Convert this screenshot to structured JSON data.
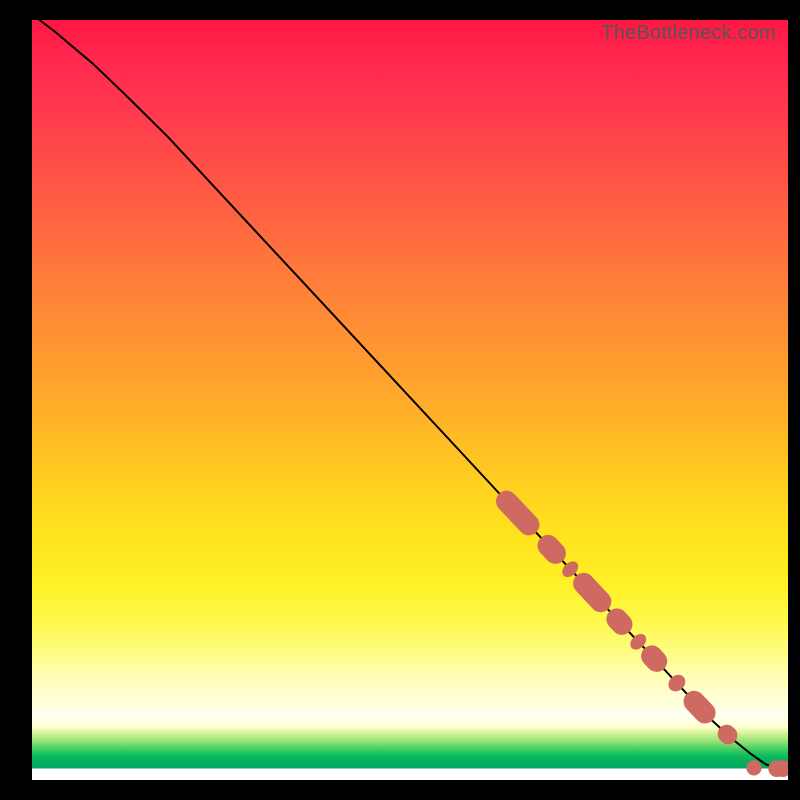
{
  "watermark": "TheBottleneck.com",
  "colors": {
    "background_frame": "#000000",
    "curve": "#000000",
    "marker": "#cf6a62",
    "gradient_top": "#ff1744",
    "gradient_mid": "#ffd91e",
    "gradient_low": "#01a85d",
    "gradient_bottom_band": "#ffffff"
  },
  "chart_data": {
    "type": "line",
    "title": "",
    "xlabel": "",
    "ylabel": "",
    "xlim": [
      0,
      100
    ],
    "ylim": [
      0,
      100
    ],
    "note": "No axis ticks or labels are rendered; values are read from the curve geometry normalized to 0–100. Curve starts near top-left, descends roughly linearly, and flattens near zero at the far right.",
    "series": [
      {
        "name": "curve",
        "x": [
          1,
          3,
          5,
          8,
          12,
          18,
          25,
          35,
          45,
          55,
          62,
          66,
          70,
          74,
          78,
          82,
          86,
          90,
          92.5,
          95,
          97,
          98.5,
          99.5
        ],
        "y": [
          100,
          98.5,
          96.8,
          94.3,
          90.5,
          84.6,
          77.1,
          66.4,
          55.7,
          45.0,
          37.5,
          33.3,
          29.0,
          24.8,
          20.5,
          16.3,
          12.0,
          7.8,
          5.5,
          3.5,
          2.1,
          1.5,
          1.5
        ]
      }
    ],
    "markers": {
      "description": "Clusters of salmon-colored elongated markers along the lower-right portion of the curve, plus two isolated round markers at the far right near y≈1.5.",
      "clusters": [
        {
          "x_start": 62.0,
          "x_end": 66.5,
          "thickness": 1.4
        },
        {
          "x_start": 67.5,
          "x_end": 70.0,
          "thickness": 1.4
        },
        {
          "x_start": 70.8,
          "x_end": 71.6,
          "thickness": 1.2
        },
        {
          "x_start": 72.2,
          "x_end": 76.0,
          "thickness": 1.4
        },
        {
          "x_start": 76.6,
          "x_end": 78.8,
          "thickness": 1.4
        },
        {
          "x_start": 79.8,
          "x_end": 80.6,
          "thickness": 1.2
        },
        {
          "x_start": 81.2,
          "x_end": 83.4,
          "thickness": 1.4
        },
        {
          "x_start": 84.8,
          "x_end": 85.8,
          "thickness": 1.2
        },
        {
          "x_start": 86.8,
          "x_end": 89.8,
          "thickness": 1.4
        },
        {
          "x_start": 91.2,
          "x_end": 92.8,
          "thickness": 1.2
        }
      ],
      "end_dots": [
        {
          "x": 95.5,
          "y": 1.6,
          "r": 1.0
        },
        {
          "x": 98.5,
          "y": 1.5,
          "r": 1.1
        },
        {
          "x": 99.3,
          "y": 1.5,
          "r": 1.1
        }
      ]
    }
  }
}
